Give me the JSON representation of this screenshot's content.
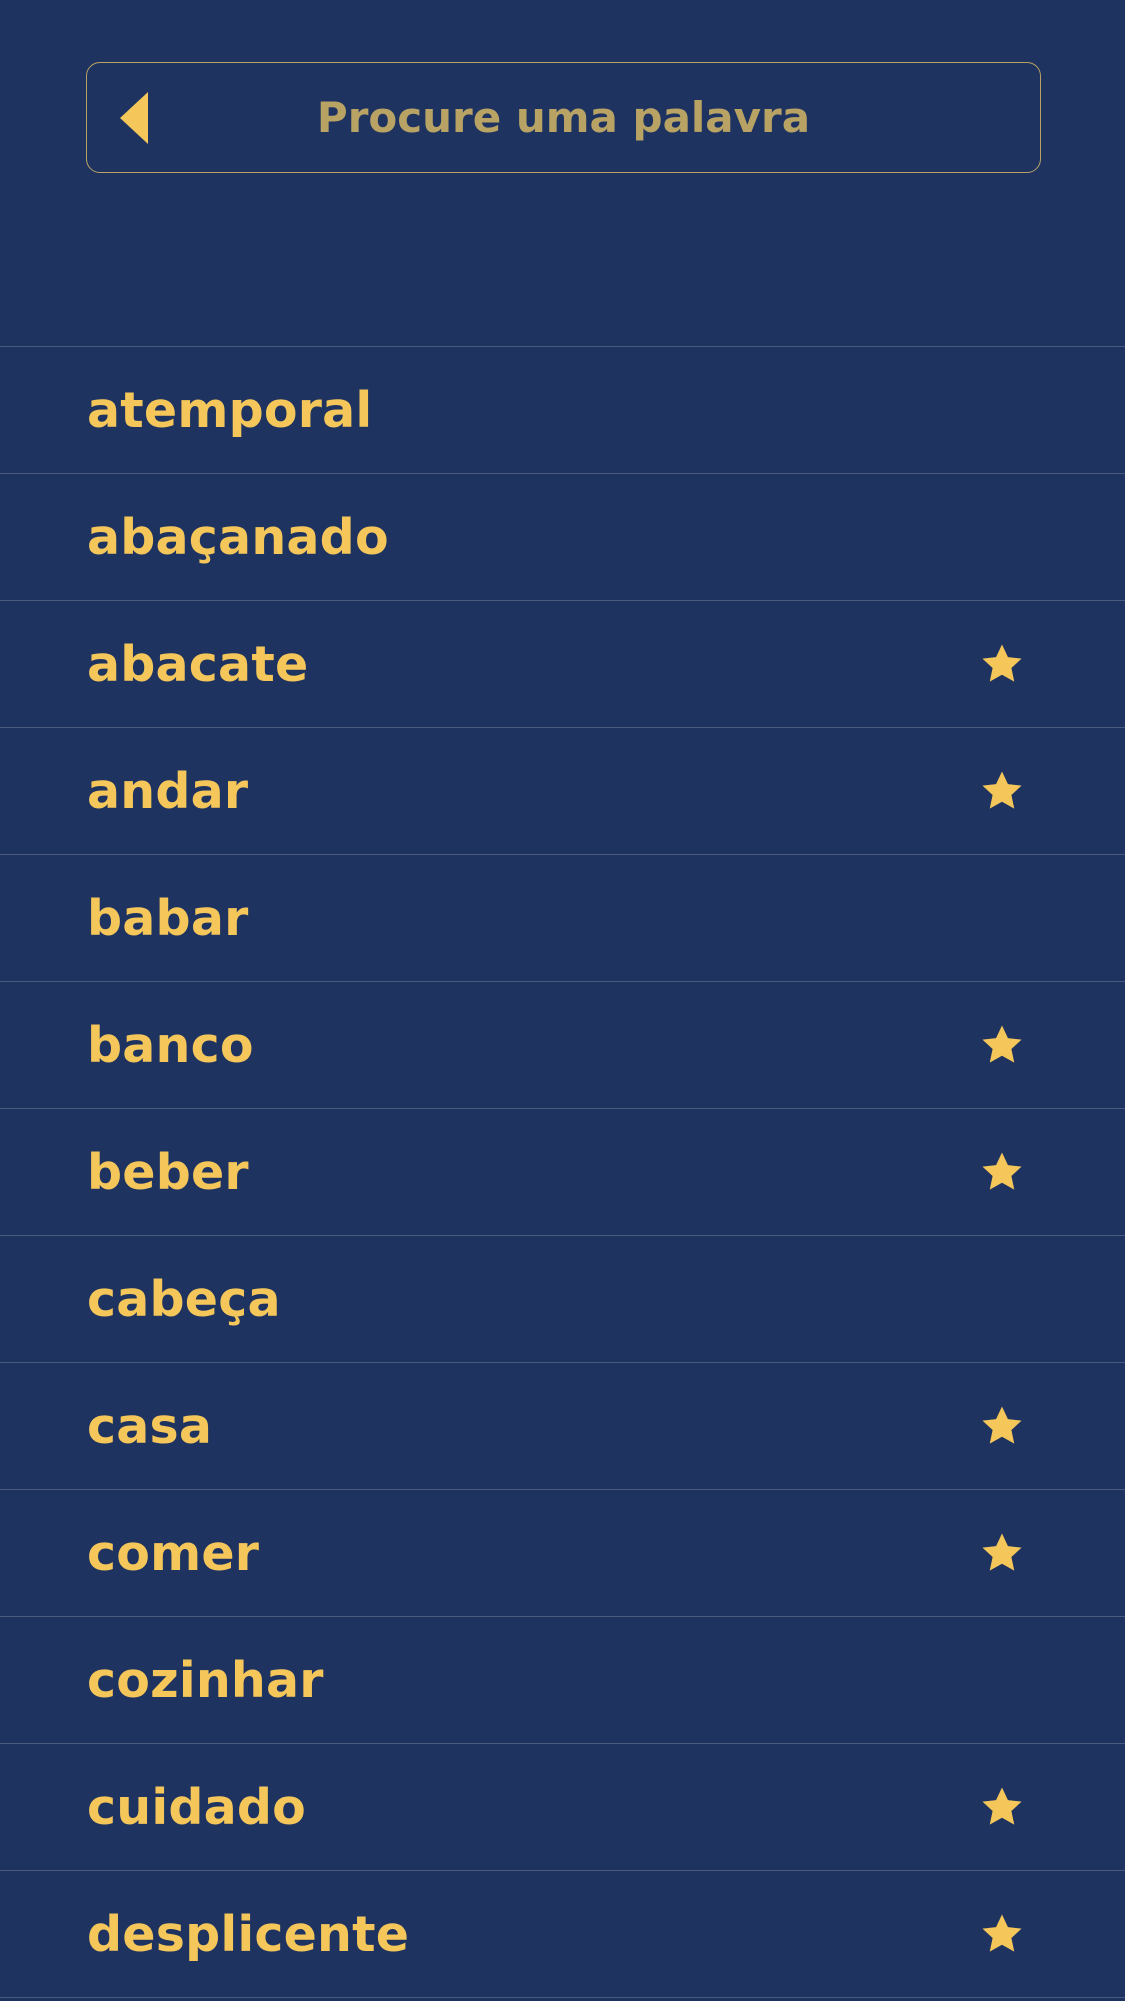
{
  "header": {
    "search_placeholder": "Procure uma palavra",
    "back_icon": "back-triangle-icon"
  },
  "colors": {
    "background": "#1e3360",
    "accent": "#f5c75a",
    "placeholder": "#b8a365",
    "divider": "#4b5a7c"
  },
  "words": [
    {
      "label": "atemporal",
      "favorite": false
    },
    {
      "label": "abaçanado",
      "favorite": false
    },
    {
      "label": "abacate",
      "favorite": true
    },
    {
      "label": "andar",
      "favorite": true
    },
    {
      "label": "babar",
      "favorite": false
    },
    {
      "label": "banco",
      "favorite": true
    },
    {
      "label": "beber",
      "favorite": true
    },
    {
      "label": "cabeça",
      "favorite": false
    },
    {
      "label": "casa",
      "favorite": true
    },
    {
      "label": "comer",
      "favorite": true
    },
    {
      "label": "cozinhar",
      "favorite": false
    },
    {
      "label": "cuidado",
      "favorite": true
    },
    {
      "label": "desplicente",
      "favorite": true
    }
  ]
}
